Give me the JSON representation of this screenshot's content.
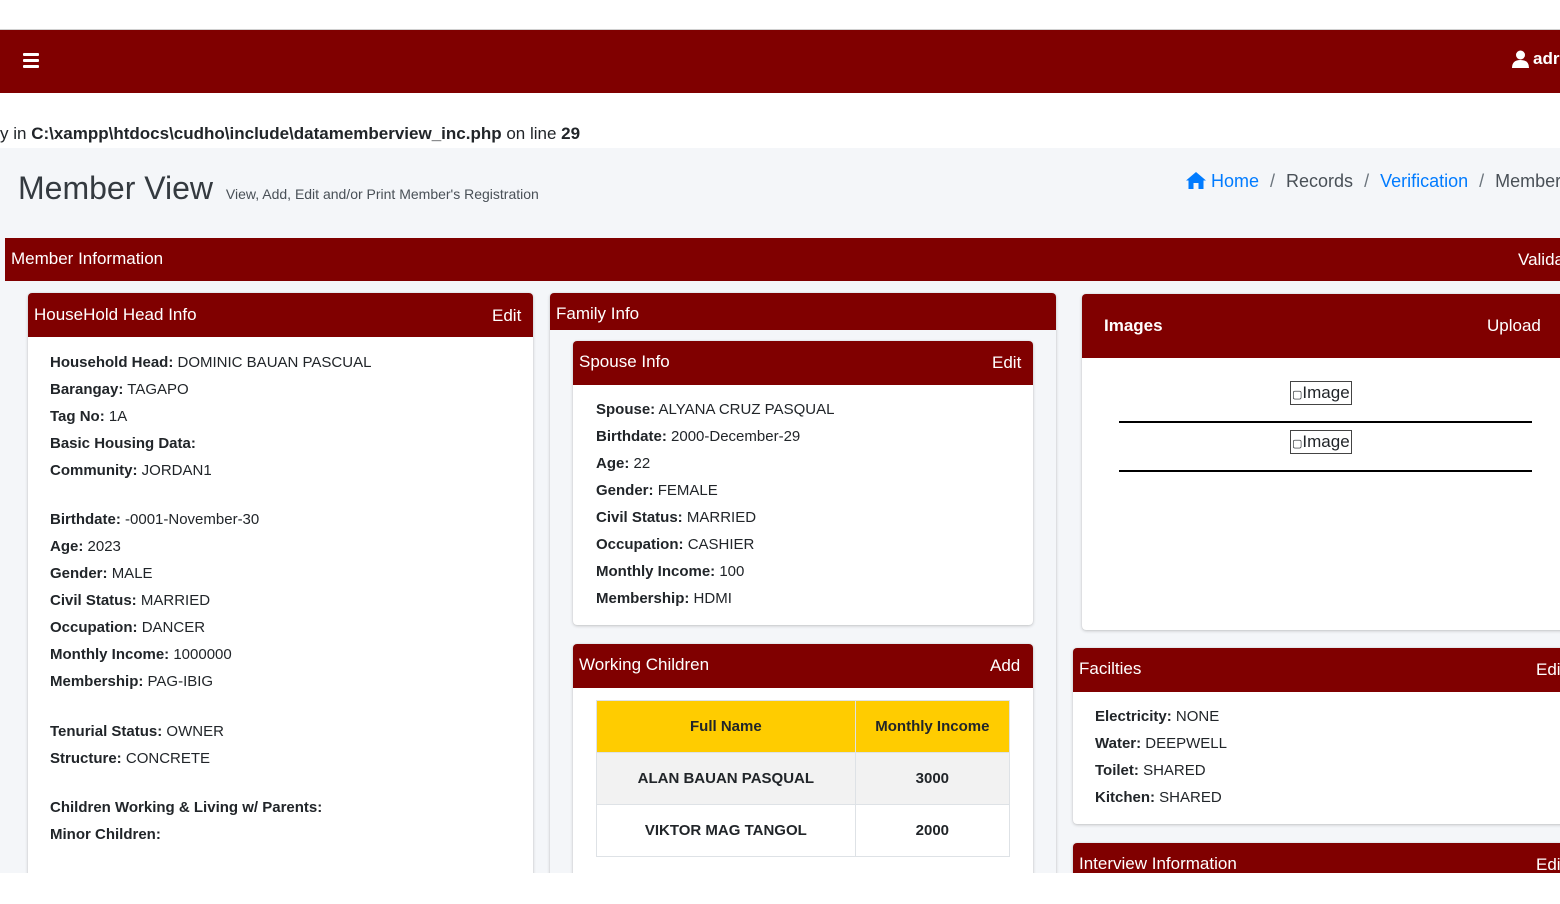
{
  "navbar": {
    "user_label": "adr"
  },
  "warning": {
    "prefix": "y in ",
    "path": "C:\\xampp\\htdocs\\cudho\\include\\datamemberview_inc.php",
    "middle": " on line ",
    "line": "29"
  },
  "page": {
    "title": "Member View",
    "subtitle": "View, Add, Edit and/or Print Member's Registration"
  },
  "breadcrumb": {
    "home": "Home",
    "records": "Records",
    "verification": "Verification",
    "current": "Member V"
  },
  "member_info": {
    "title": "Member Information",
    "right_label": "Valida"
  },
  "household": {
    "title": "HouseHold Head Info",
    "edit_label": "Edit",
    "rows": [
      {
        "label": "Household Head:",
        "value": "DOMINIC BAUAN PASCUAL"
      },
      {
        "label": "Barangay:",
        "value": "TAGAPO"
      },
      {
        "label": "Tag No:",
        "value": "1A"
      },
      {
        "label": "Basic Housing Data:",
        "value": ""
      },
      {
        "label": "Community:",
        "value": "JORDAN1"
      },
      {
        "label": "Birthdate:",
        "value": "-0001-November-30"
      },
      {
        "label": "Age:",
        "value": "2023"
      },
      {
        "label": "Gender:",
        "value": "MALE"
      },
      {
        "label": "Civil Status:",
        "value": "MARRIED"
      },
      {
        "label": "Occupation:",
        "value": "DANCER"
      },
      {
        "label": "Monthly Income:",
        "value": "1000000"
      },
      {
        "label": "Membership:",
        "value": "PAG-IBIG"
      },
      {
        "label": "Tenurial Status:",
        "value": "OWNER"
      },
      {
        "label": "Structure:",
        "value": "CONCRETE"
      },
      {
        "label": "Children Working & Living w/ Parents:",
        "value": ""
      },
      {
        "label": "Minor Children:",
        "value": ""
      }
    ]
  },
  "family": {
    "title": "Family Info",
    "spouse": {
      "title": "Spouse Info",
      "edit_label": "Edit",
      "rows": [
        {
          "label": "Spouse:",
          "value": "ALYANA CRUZ PASQUAL"
        },
        {
          "label": "Birthdate:",
          "value": "2000-December-29"
        },
        {
          "label": "Age:",
          "value": "22"
        },
        {
          "label": "Gender:",
          "value": "FEMALE"
        },
        {
          "label": "Civil Status:",
          "value": "MARRIED"
        },
        {
          "label": "Occupation:",
          "value": "CASHIER"
        },
        {
          "label": "Monthly Income:",
          "value": "100"
        },
        {
          "label": "Membership:",
          "value": "HDMI"
        }
      ]
    },
    "working_children": {
      "title": "Working Children",
      "add_label": "Add",
      "columns": [
        "Full Name",
        "Monthly Income"
      ],
      "rows": [
        [
          "ALAN BAUAN PASQUAL",
          "3000"
        ],
        [
          "VIKTOR MAG TANGOL",
          "2000"
        ]
      ]
    }
  },
  "images": {
    "title": "Images",
    "upload_label": "Upload",
    "alt_texts": [
      "Image",
      "Image"
    ]
  },
  "facilities": {
    "title": "Facilties",
    "edit_label": "Edi",
    "rows": [
      {
        "label": "Electricity:",
        "value": "NONE"
      },
      {
        "label": "Water:",
        "value": "DEEPWELL"
      },
      {
        "label": "Toilet:",
        "value": "SHARED"
      },
      {
        "label": "Kitchen:",
        "value": "SHARED"
      }
    ]
  },
  "interview": {
    "title": "Interview Information",
    "edit_label": "Edi"
  },
  "colors": {
    "brand": "#800000",
    "table_header": "#ffcc00",
    "link": "#007bff",
    "content_bg": "#f4f6f9"
  }
}
